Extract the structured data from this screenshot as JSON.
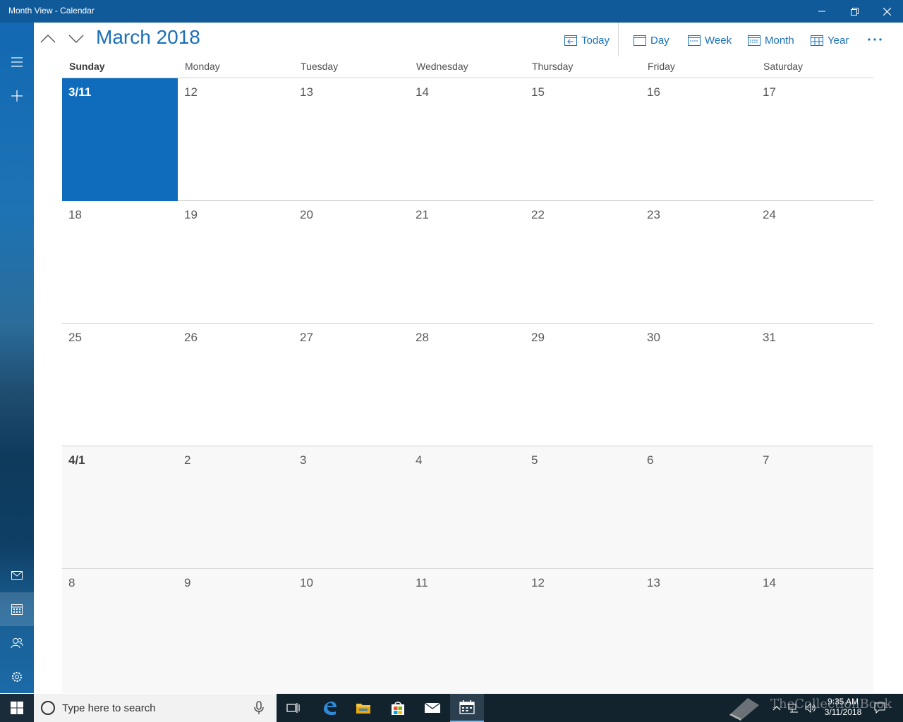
{
  "window": {
    "title": "Month View - Calendar",
    "accent": "#115a99"
  },
  "header": {
    "month_title": "March 2018",
    "commands": {
      "today": "Today",
      "day": "Day",
      "week": "Week",
      "month": "Month",
      "year": "Year"
    }
  },
  "weekdays": [
    "Sunday",
    "Monday",
    "Tuesday",
    "Wednesday",
    "Thursday",
    "Friday",
    "Saturday"
  ],
  "weeks": [
    [
      "3/11",
      "12",
      "13",
      "14",
      "15",
      "16",
      "17"
    ],
    [
      "18",
      "19",
      "20",
      "21",
      "22",
      "23",
      "24"
    ],
    [
      "25",
      "26",
      "27",
      "28",
      "29",
      "30",
      "31"
    ],
    [
      "4/1",
      "2",
      "3",
      "4",
      "5",
      "6",
      "7"
    ],
    [
      "8",
      "9",
      "10",
      "11",
      "12",
      "13",
      "14"
    ]
  ],
  "today_cell": "3/11",
  "today_color": "#0f6cbd",
  "taskbar": {
    "search_placeholder": "Type here to search",
    "time": "9:35 AM",
    "date": "3/11/2018"
  },
  "watermark": "TheCollectionBook",
  "icons": {
    "rail": [
      "hamburger-icon",
      "plus-icon",
      "mail-icon",
      "calendar-icon",
      "people-icon",
      "settings-icon"
    ],
    "taskbar": [
      "windows-icon",
      "cortana-icon",
      "mic-icon",
      "task-view-icon",
      "edge-icon",
      "file-explorer-icon",
      "store-icon",
      "mail-icon",
      "calendar-icon"
    ]
  }
}
